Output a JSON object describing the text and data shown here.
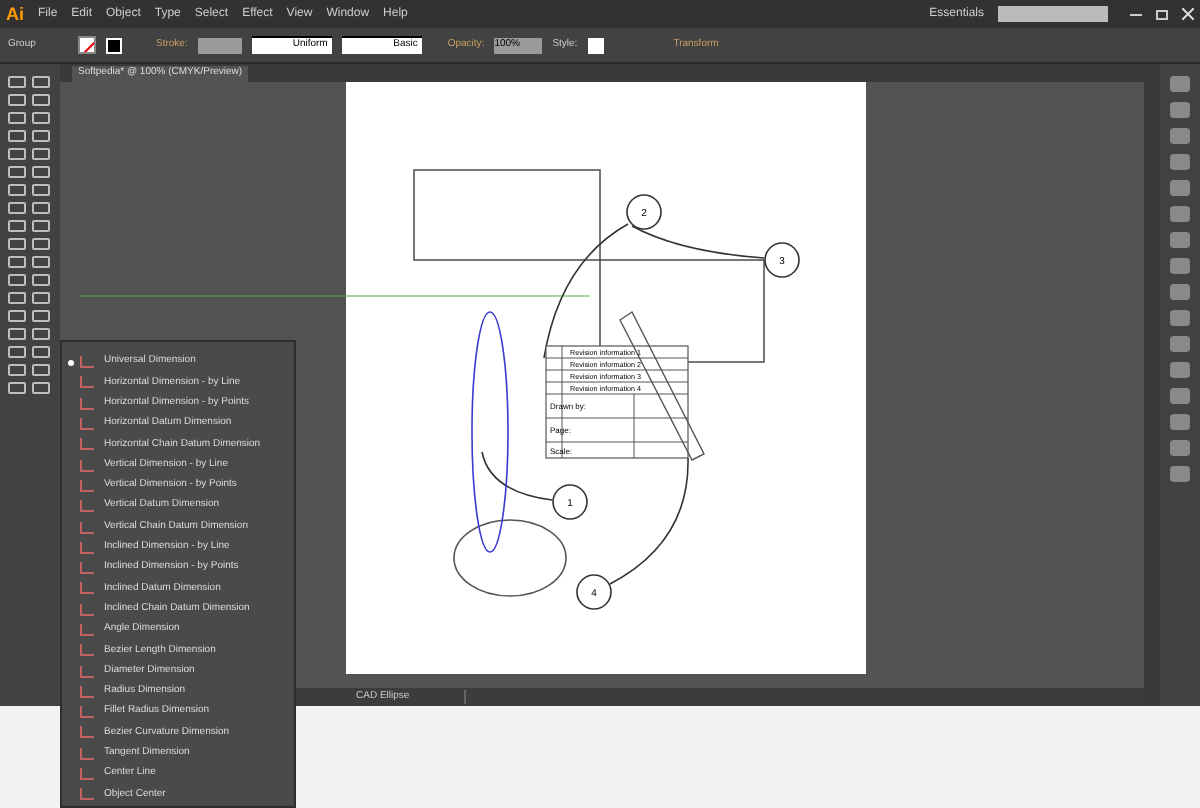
{
  "app_logo": "Ai",
  "menu_bar": [
    "File",
    "Edit",
    "Object",
    "Type",
    "Select",
    "Effect",
    "View",
    "Window",
    "Help"
  ],
  "workspace": "Essentials",
  "control_bar": {
    "selection": "Group",
    "stroke_label": "Stroke:",
    "profile": "Uniform",
    "brush": "Basic",
    "opacity_label": "Opacity:",
    "opacity": "100%",
    "style_label": "Style:",
    "transform": "Transform"
  },
  "document_tab": "Softpedia* @ 100% (CMYK/Preview)",
  "callouts": [
    "1",
    "2",
    "3",
    "4"
  ],
  "title_block": [
    "Revision information 1",
    "Revision information 2",
    "Revision information 3",
    "Revision information 4",
    "Drawn by:",
    "Page:",
    "Scale:"
  ],
  "dimension_menu": [
    {
      "label": "Universal Dimension",
      "selected": true
    },
    {
      "label": "Horizontal Dimension - by Line",
      "selected": false
    },
    {
      "label": "Horizontal Dimension - by Points",
      "selected": false
    },
    {
      "label": "Horizontal Datum Dimension",
      "selected": false
    },
    {
      "label": "Horizontal Chain Datum Dimension",
      "selected": false
    },
    {
      "label": "Vertical Dimension - by Line",
      "selected": false
    },
    {
      "label": "Vertical Dimension - by Points",
      "selected": false
    },
    {
      "label": "Vertical Datum Dimension",
      "selected": false
    },
    {
      "label": "Vertical Chain Datum Dimension",
      "selected": false
    },
    {
      "label": "Inclined Dimension - by Line",
      "selected": false
    },
    {
      "label": "Inclined Dimension - by Points",
      "selected": false
    },
    {
      "label": "Inclined Datum Dimension",
      "selected": false
    },
    {
      "label": "Inclined Chain Datum Dimension",
      "selected": false
    },
    {
      "label": "Angle Dimension",
      "selected": false
    },
    {
      "label": "Bezier Length Dimension",
      "selected": false
    },
    {
      "label": "Diameter Dimension",
      "selected": false
    },
    {
      "label": "Radius Dimension",
      "selected": false
    },
    {
      "label": "Fillet Radius Dimension",
      "selected": false
    },
    {
      "label": "Bezier Curvature Dimension",
      "selected": false
    },
    {
      "label": "Tangent Dimension",
      "selected": false
    },
    {
      "label": "Center Line",
      "selected": false
    },
    {
      "label": "Object Center",
      "selected": false
    }
  ],
  "status_bar": "CAD Ellipse"
}
